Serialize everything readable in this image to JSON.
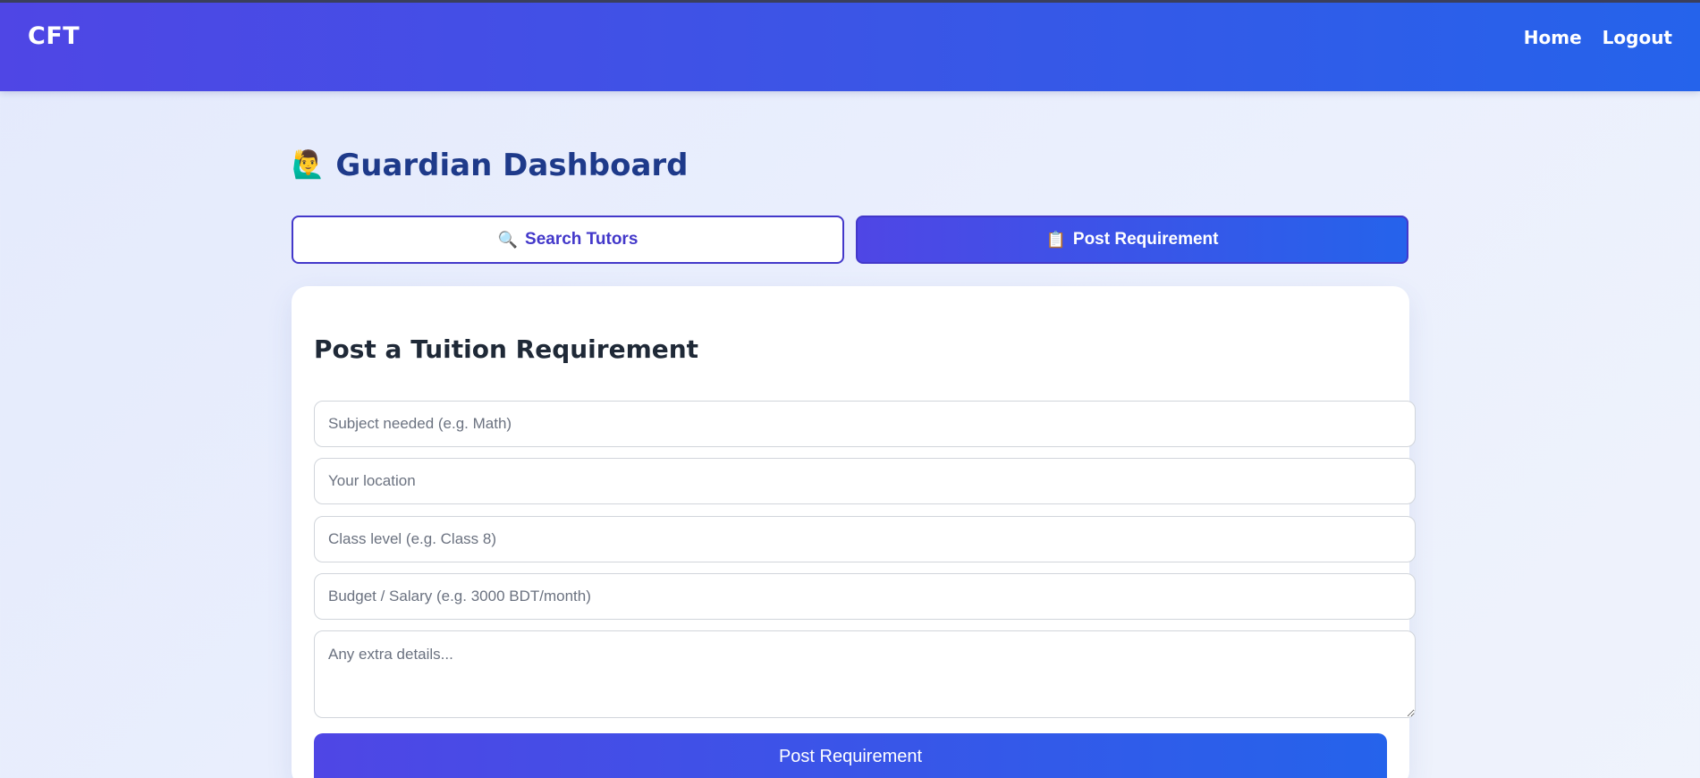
{
  "navbar": {
    "brand": "CFT",
    "links": [
      "Home",
      "Logout"
    ]
  },
  "page": {
    "title_icon": "🙋‍♂️",
    "title": "Guardian Dashboard"
  },
  "tabs": [
    {
      "icon": "🔍",
      "label": "Search Tutors",
      "active": false
    },
    {
      "icon": "📋",
      "label": "Post Requirement",
      "active": true
    }
  ],
  "form": {
    "title": "Post a Tuition Requirement",
    "subject_placeholder": "Subject needed (e.g. Math)",
    "location_placeholder": "Your location",
    "class_placeholder": "Class level (e.g. Class 8)",
    "budget_placeholder": "Budget / Salary (e.g. 3000 BDT/month)",
    "details_placeholder": "Any extra details...",
    "submit_label": "Post Requirement"
  },
  "colors": {
    "primary_start": "#4f46e5",
    "primary_end": "#2563eb",
    "heading": "#1e3a8a"
  }
}
